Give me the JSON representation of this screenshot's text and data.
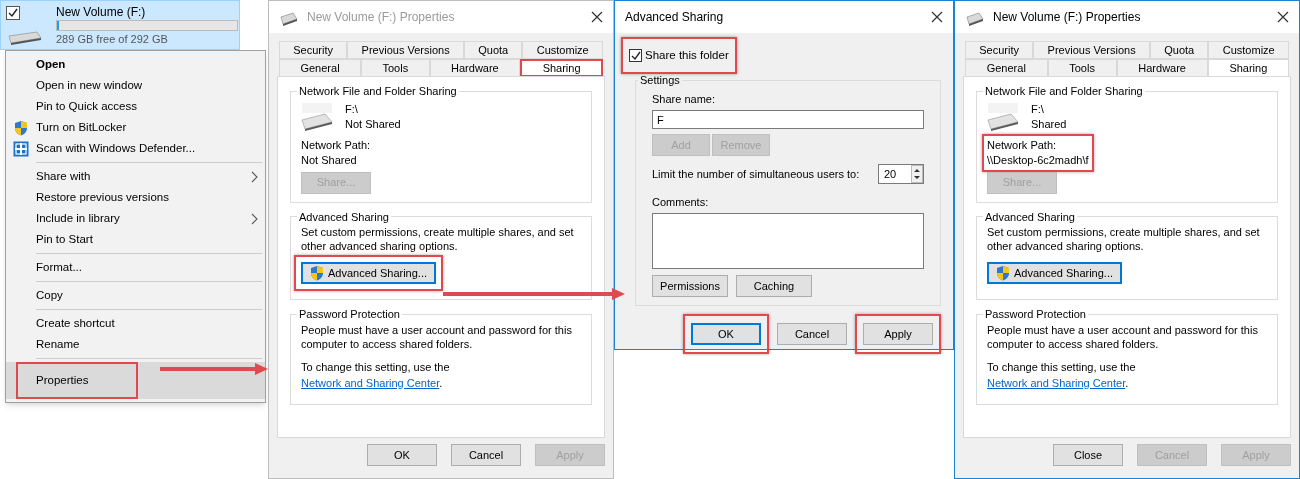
{
  "drive_tile": {
    "label": "New Volume (F:)",
    "checked": true,
    "level": 0.01,
    "free_space": "289 GB free of 292 GB"
  },
  "context_menu": {
    "items": [
      {
        "kind": "item",
        "label": "Open",
        "bold": true,
        "submenu": false,
        "selected": false,
        "highlighted": false
      },
      {
        "kind": "item",
        "label": "Open in new window",
        "bold": false,
        "submenu": false,
        "selected": false,
        "highlighted": false
      },
      {
        "kind": "item",
        "label": "Pin to Quick access",
        "bold": false,
        "submenu": false,
        "selected": false,
        "highlighted": false
      },
      {
        "kind": "uac-item",
        "label": "Turn on BitLocker",
        "bold": false,
        "submenu": false,
        "selected": false,
        "highlighted": false
      },
      {
        "kind": "defender-item",
        "label": "Scan with Windows Defender...",
        "bold": false,
        "submenu": false,
        "selected": false,
        "highlighted": false
      },
      {
        "kind": "separator"
      },
      {
        "kind": "item",
        "label": "Share with",
        "bold": false,
        "submenu": true,
        "selected": false,
        "highlighted": false
      },
      {
        "kind": "item",
        "label": "Restore previous versions",
        "bold": false,
        "submenu": false,
        "selected": false,
        "highlighted": false
      },
      {
        "kind": "item",
        "label": "Include in library",
        "bold": false,
        "submenu": true,
        "selected": false,
        "highlighted": false
      },
      {
        "kind": "item",
        "label": "Pin to Start",
        "bold": false,
        "submenu": false,
        "selected": false,
        "highlighted": false
      },
      {
        "kind": "separator"
      },
      {
        "kind": "item",
        "label": "Format...",
        "bold": false,
        "submenu": false,
        "selected": false,
        "highlighted": false
      },
      {
        "kind": "separator"
      },
      {
        "kind": "item",
        "label": "Copy",
        "bold": false,
        "submenu": false,
        "selected": false,
        "highlighted": false
      },
      {
        "kind": "separator"
      },
      {
        "kind": "item",
        "label": "Create shortcut",
        "bold": false,
        "submenu": false,
        "selected": false,
        "highlighted": false
      },
      {
        "kind": "item",
        "label": "Rename",
        "bold": false,
        "submenu": false,
        "selected": false,
        "highlighted": false
      },
      {
        "kind": "separator"
      },
      {
        "kind": "item",
        "label": "Properties",
        "bold": false,
        "submenu": false,
        "selected": true,
        "highlighted": true
      }
    ]
  },
  "properties_before": {
    "title": "New Volume (F:) Properties",
    "active": false,
    "tabs_row1": [
      {
        "label": "Security",
        "selected": false,
        "highlighted": false
      },
      {
        "label": "Previous Versions",
        "selected": false,
        "highlighted": false
      },
      {
        "label": "Quota",
        "selected": false,
        "highlighted": false
      },
      {
        "label": "Customize",
        "selected": false,
        "highlighted": false
      }
    ],
    "tabs_row2": [
      {
        "label": "General",
        "selected": false,
        "highlighted": false
      },
      {
        "label": "Tools",
        "selected": false,
        "highlighted": false
      },
      {
        "label": "Hardware",
        "selected": false,
        "highlighted": false
      },
      {
        "label": "Sharing",
        "selected": true,
        "highlighted": true
      }
    ],
    "network_group": {
      "title": "Network File and Folder Sharing",
      "path": "F:\\",
      "status": "Not Shared",
      "network_path_label": "Network Path:",
      "network_path": "Not Shared",
      "highlighted": false,
      "share_button": {
        "label": "Share...",
        "disabled": true,
        "focused": false
      }
    },
    "advanced_group": {
      "title": "Advanced Sharing",
      "description": "Set custom permissions, create multiple shares, and set other advanced sharing options.",
      "button": {
        "label": "Advanced Sharing...",
        "disabled": false,
        "highlighted": true,
        "focused": true
      }
    },
    "password_group": {
      "title": "Password Protection",
      "text": "People must have a user account and password for this computer to access shared folders.",
      "hint_prefix": "To change this setting, use the ",
      "link": "Network and Sharing Center",
      "hint_suffix": "."
    },
    "buttons": [
      {
        "label": "OK",
        "disabled": false,
        "highlighted": false,
        "focused": false
      },
      {
        "label": "Cancel",
        "disabled": false,
        "highlighted": false,
        "focused": false
      },
      {
        "label": "Apply",
        "disabled": true,
        "highlighted": false,
        "focused": false
      }
    ]
  },
  "advanced_sharing": {
    "title": "Advanced Sharing",
    "share_checkbox": {
      "label": "Share this folder",
      "checked": true,
      "highlighted": true
    },
    "settings_title": "Settings",
    "share_name_label": "Share name:",
    "share_name": "F",
    "add_button": {
      "label": "Add",
      "disabled": true,
      "focused": false
    },
    "remove_button": {
      "label": "Remove",
      "disabled": true,
      "focused": false
    },
    "limit_label": "Limit the number of simultaneous users to:",
    "limit_value": "20",
    "comments_label": "Comments:",
    "permissions_button": {
      "label": "Permissions",
      "disabled": false,
      "focused": false
    },
    "caching_button": {
      "label": "Caching",
      "disabled": false,
      "focused": false
    },
    "buttons": [
      {
        "label": "OK",
        "disabled": false,
        "highlighted": true,
        "focused": true
      },
      {
        "label": "Cancel",
        "disabled": false,
        "highlighted": false,
        "focused": false
      },
      {
        "label": "Apply",
        "disabled": false,
        "highlighted": true,
        "focused": false
      }
    ]
  },
  "properties_after": {
    "title": "New Volume (F:) Properties",
    "active": true,
    "tabs_row1": [
      {
        "label": "Security",
        "selected": false,
        "highlighted": false
      },
      {
        "label": "Previous Versions",
        "selected": false,
        "highlighted": false
      },
      {
        "label": "Quota",
        "selected": false,
        "highlighted": false
      },
      {
        "label": "Customize",
        "selected": false,
        "highlighted": false
      }
    ],
    "tabs_row2": [
      {
        "label": "General",
        "selected": false,
        "highlighted": false
      },
      {
        "label": "Tools",
        "selected": false,
        "highlighted": false
      },
      {
        "label": "Hardware",
        "selected": false,
        "highlighted": false
      },
      {
        "label": "Sharing",
        "selected": true,
        "highlighted": false
      }
    ],
    "network_group": {
      "title": "Network File and Folder Sharing",
      "path": "F:\\",
      "status": "Shared",
      "network_path_label": "Network Path:",
      "network_path": "\\\\Desktop-6c2madh\\f",
      "highlighted": true,
      "share_button": {
        "label": "Share...",
        "disabled": true,
        "focused": false
      }
    },
    "advanced_group": {
      "title": "Advanced Sharing",
      "description": "Set custom permissions, create multiple shares, and set other advanced sharing options.",
      "button": {
        "label": "Advanced Sharing...",
        "disabled": false,
        "highlighted": false,
        "focused": true
      }
    },
    "password_group": {
      "title": "Password Protection",
      "text": "People must have a user account and password for this computer to access shared folders.",
      "hint_prefix": "To change this setting, use the ",
      "link": "Network and Sharing Center",
      "hint_suffix": "."
    },
    "buttons": [
      {
        "label": "Close",
        "disabled": false,
        "highlighted": false,
        "focused": false
      },
      {
        "label": "Cancel",
        "disabled": true,
        "highlighted": false,
        "focused": false
      },
      {
        "label": "Apply",
        "disabled": true,
        "highlighted": false,
        "focused": false
      }
    ]
  }
}
